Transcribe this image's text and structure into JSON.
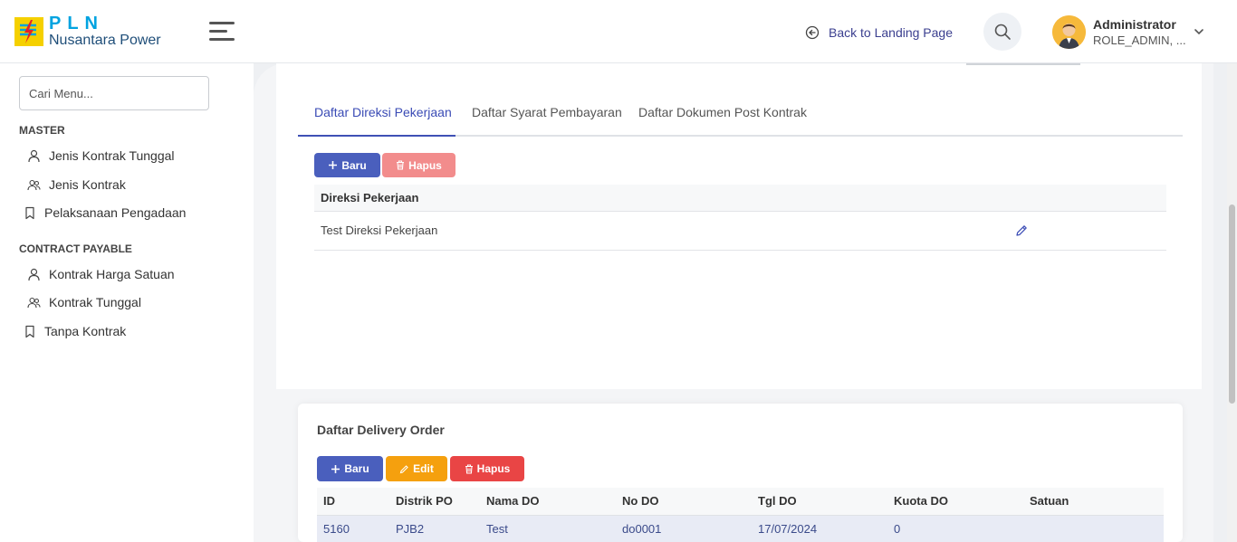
{
  "brand": {
    "title": "PLN",
    "subtitle": "Nusantara Power"
  },
  "header": {
    "back_label": "Back to Landing Page",
    "user_name": "Administrator",
    "user_role": "ROLE_ADMIN, ..."
  },
  "sidebar": {
    "search_placeholder": "Cari Menu...",
    "sections": [
      {
        "title": "MASTER",
        "items": [
          {
            "label": "Jenis Kontrak Tunggal",
            "icon": "user-icon"
          },
          {
            "label": "Jenis Kontrak",
            "icon": "users-icon"
          },
          {
            "label": "Pelaksanaan Pengadaan",
            "icon": "bookmark-icon"
          }
        ]
      },
      {
        "title": "CONTRACT PAYABLE",
        "items": [
          {
            "label": "Kontrak Harga Satuan",
            "icon": "user-icon"
          },
          {
            "label": "Kontrak Tunggal",
            "icon": "users-icon"
          },
          {
            "label": "Tanpa Kontrak",
            "icon": "bookmark-icon"
          }
        ]
      }
    ]
  },
  "tabs": [
    {
      "label": "Daftar Direksi Pekerjaan",
      "active": true
    },
    {
      "label": "Daftar Syarat Pembayaran",
      "active": false
    },
    {
      "label": "Daftar Dokumen Post Kontrak",
      "active": false
    }
  ],
  "direksi": {
    "new_label": "Baru",
    "delete_label": "Hapus",
    "column": "Direksi Pekerjaan",
    "rows": [
      "Test Direksi Pekerjaan"
    ]
  },
  "delivery": {
    "title": "Daftar Delivery Order",
    "new_label": "Baru",
    "edit_label": "Edit",
    "delete_label": "Hapus",
    "columns": [
      "ID",
      "Distrik PO",
      "Nama DO",
      "No DO",
      "Tgl DO",
      "Kuota DO",
      "Satuan"
    ],
    "rows": [
      [
        "5160",
        "PJB2",
        "Test",
        "do0001",
        "17/07/2024",
        "0",
        ""
      ]
    ]
  },
  "colors": {
    "primary": "#4a5fbd",
    "danger": "#e94545",
    "danger_light": "#f28c8c",
    "warning": "#f5a00e",
    "brand_blue": "#00a3e0",
    "brand_yellow": "#f5d000"
  }
}
